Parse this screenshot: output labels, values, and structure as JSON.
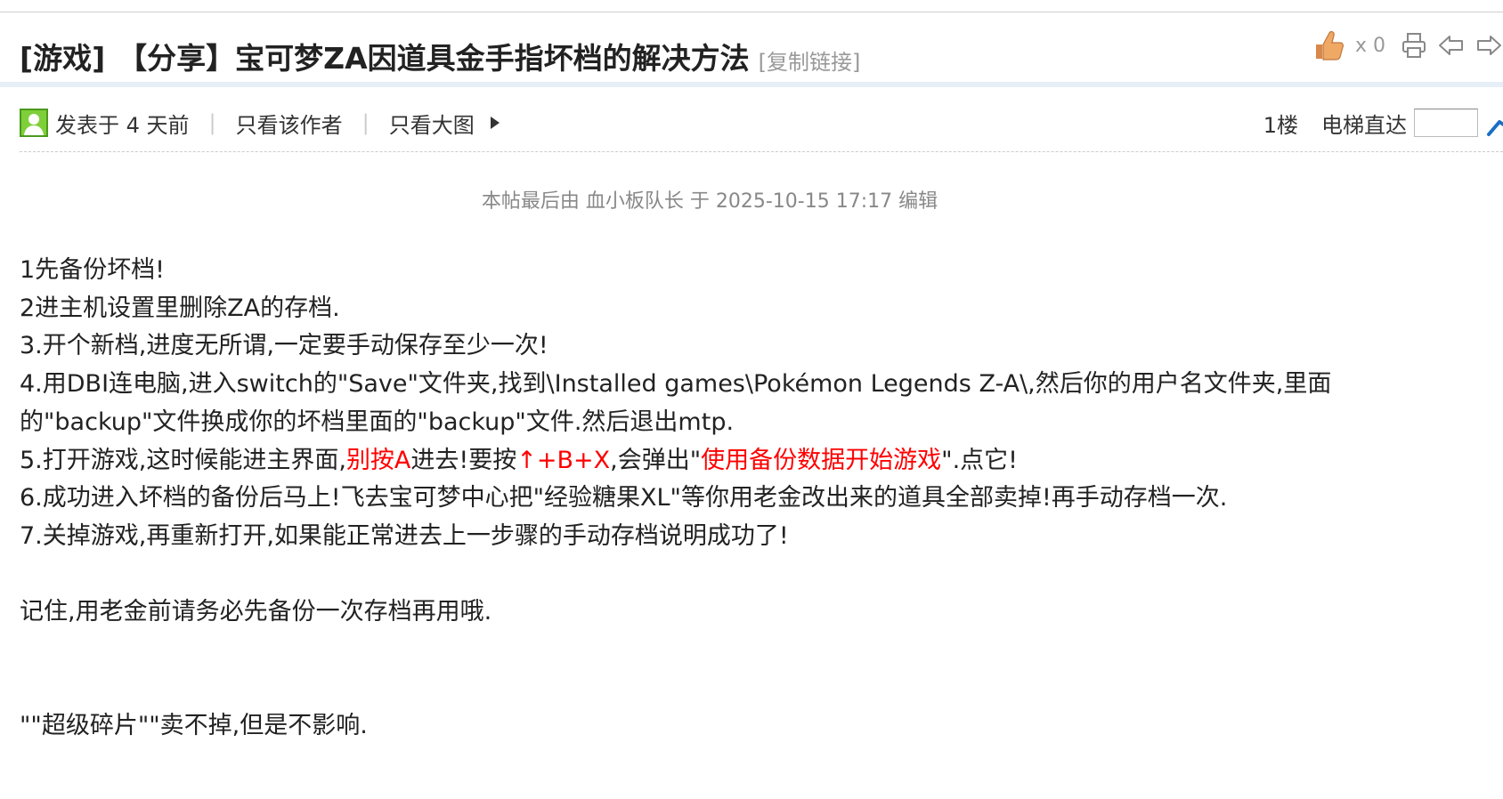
{
  "title": {
    "category": "[游戏]",
    "text": "【分享】宝可梦ZA因道具金手指坏档的解决方法",
    "copy_link": "[复制链接]",
    "like_count": "x 0",
    "icons": [
      "thumbs-up-icon",
      "print-icon",
      "prev-icon",
      "next-icon"
    ]
  },
  "meta": {
    "posted": "发表于 4 天前",
    "sep": "|",
    "only_author": "只看该作者",
    "only_big_image": "只看大图",
    "floor": "1楼",
    "goto_label": "电梯直达",
    "goto_value": ""
  },
  "edit_note": "本帖最后由 血小板队长 于 2025-10-15 17:17 编辑",
  "content": {
    "step1": "1先备份坏档!",
    "step2": "2进主机设置里删除ZA的存档.",
    "step3": "3.开个新档,进度无所谓,一定要手动保存至少一次!",
    "step4a": "4.用DBI连电脑,进入switch的\"Save\"文件夹,找到\\Installed games\\Pokémon Legends Z-A\\,然后你的用户名文件夹,里面",
    "step4b": "的\"backup\"文件换成你的坏档里面的\"backup\"文件.然后退出mtp.",
    "step5_p1": "5.打开游戏,这时候能进主界面,",
    "step5_r1": "别按A",
    "step5_p2": "进去!要按",
    "step5_r2": "↑+B+X",
    "step5_p3": ",会弹出\"",
    "step5_r3": "使用备份数据开始游戏",
    "step5_p4": "\".点它!",
    "step6": "6.成功进入坏档的备份后马上!飞去宝可梦中心把\"经验糖果XL\"等你用老金改出来的道具全部卖掉!再手动存档一次.",
    "step7": "7.关掉游戏,再重新打开,如果能正常进去上一步骤的手动存档说明成功了!",
    "remember": "记住,用老金前请务必先备份一次存档再用哦.",
    "note": "\"\"超级碎片\"\"卖不掉,但是不影响."
  },
  "colors": {
    "highlight": "#ff0000",
    "band": "#e6eef7"
  }
}
